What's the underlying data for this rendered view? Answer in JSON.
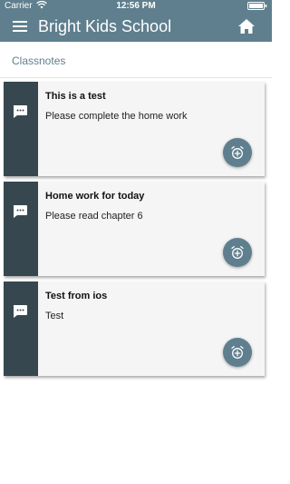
{
  "status_bar": {
    "carrier": "Carrier",
    "time": "12:56 PM",
    "wifi_icon": "wifi-icon",
    "battery_icon": "battery-icon"
  },
  "app_bar": {
    "title": "Bright Kids School",
    "menu_icon": "hamburger-menu-icon",
    "home_icon": "home-icon",
    "background_color": "#5f7f8e"
  },
  "page": {
    "title": "Classnotes"
  },
  "notes": [
    {
      "title": "This is a test",
      "body": "Please complete the home work"
    },
    {
      "title": "Home work for today",
      "body": "Please read chapter 6"
    },
    {
      "title": "Test from ios",
      "body": "Test"
    }
  ],
  "colors": {
    "card_rail": "#36474f",
    "card_background": "#f5f5f5",
    "accent": "#5f7f8e"
  },
  "icons": {
    "card_left_icon": "chat-bubble-icon",
    "card_action_icon": "alarm-add-icon"
  }
}
